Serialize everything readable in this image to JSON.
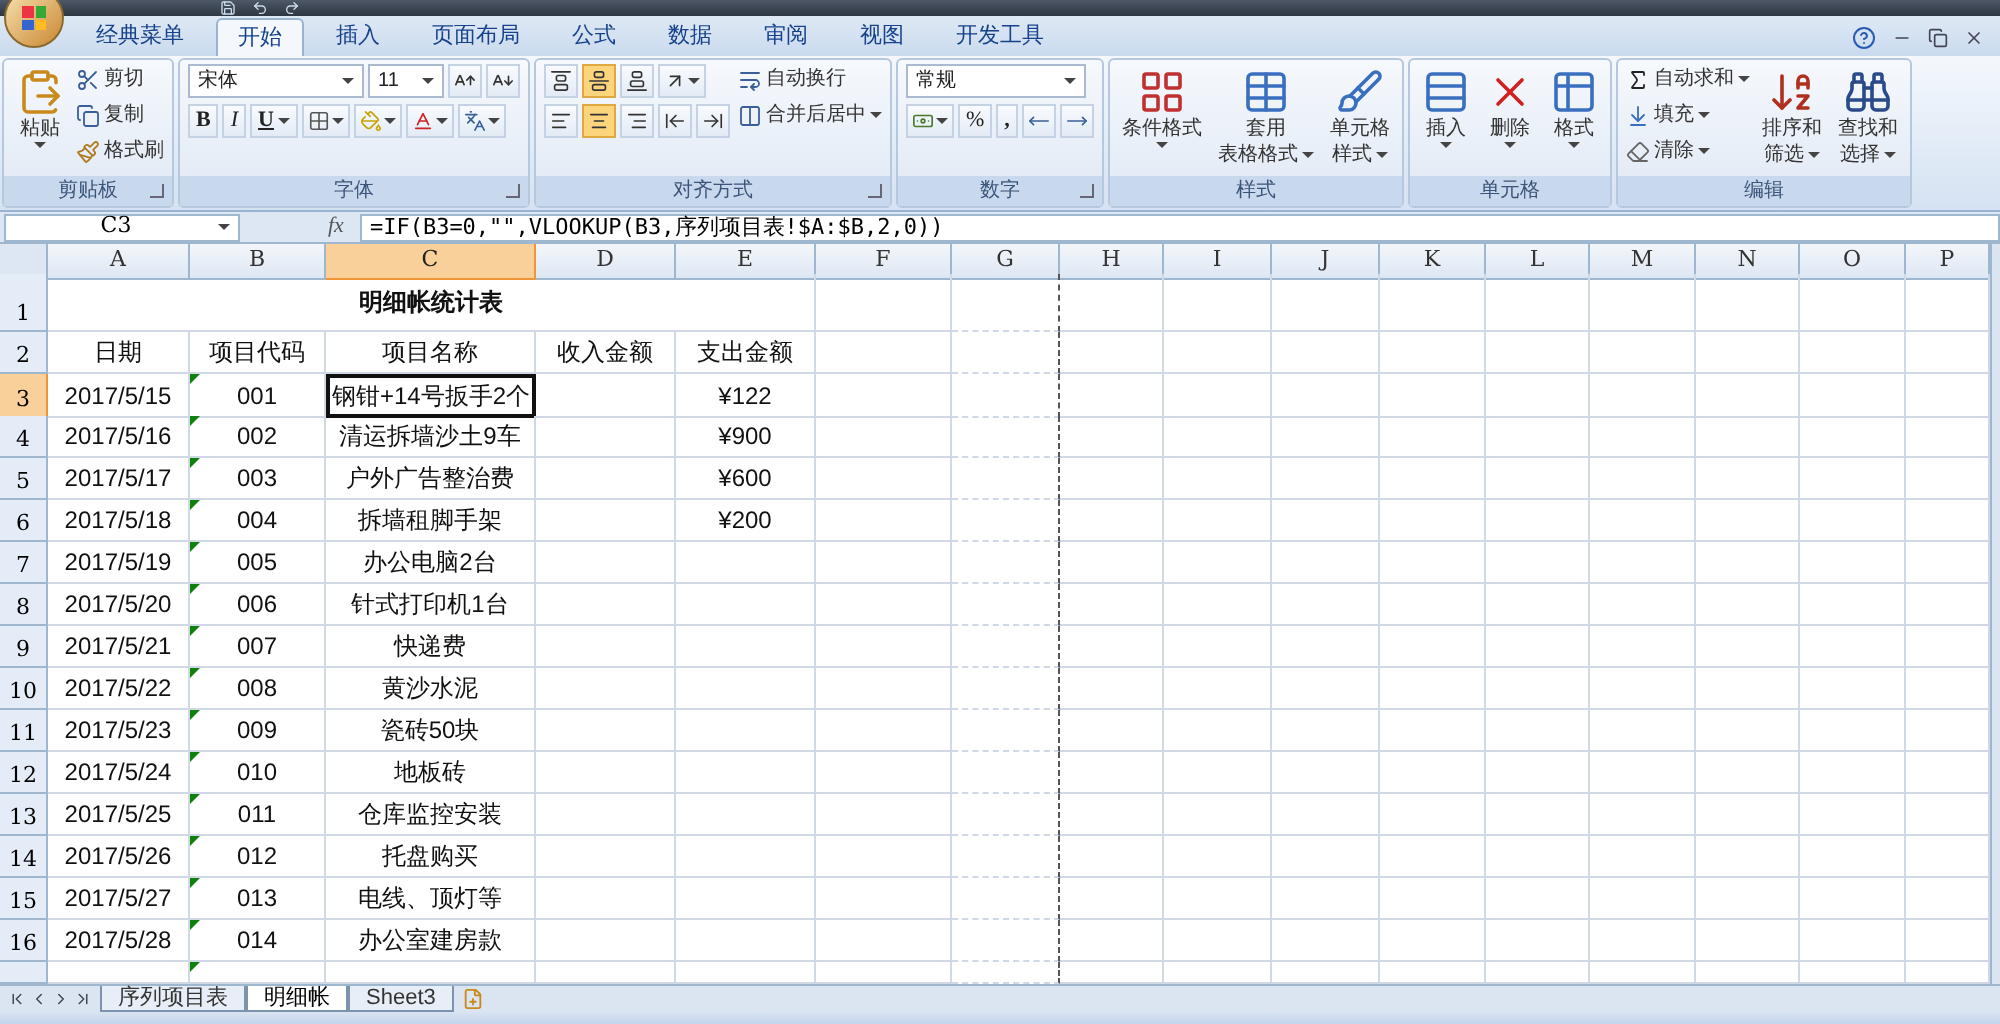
{
  "ribbon_tabs": [
    {
      "label": "经典菜单",
      "selected": false
    },
    {
      "label": "开始",
      "selected": true
    },
    {
      "label": "插入",
      "selected": false
    },
    {
      "label": "页面布局",
      "selected": false
    },
    {
      "label": "公式",
      "selected": false
    },
    {
      "label": "数据",
      "selected": false
    },
    {
      "label": "审阅",
      "selected": false
    },
    {
      "label": "视图",
      "selected": false
    },
    {
      "label": "开发工具",
      "selected": false
    }
  ],
  "ribbon_groups": [
    {
      "label": "剪贴板",
      "launcher": true,
      "columns": [
        [
          {
            "kind": "large",
            "lines": [
              "粘贴"
            ],
            "dropdown": true
          }
        ],
        [
          {
            "kind": "small",
            "label": "剪切",
            "dropdown": false
          },
          {
            "kind": "small",
            "label": "复制",
            "dropdown": false
          },
          {
            "kind": "small",
            "label": "格式刷",
            "dropdown": false
          }
        ]
      ]
    },
    {
      "label": "字体",
      "launcher": true,
      "columns": [
        [
          {
            "kind": "row",
            "items": [
              {
                "kind": "combo",
                "value": "宋体"
              },
              {
                "kind": "combo",
                "value": "11"
              },
              {
                "kind": "icon",
                "dropdown": false
              },
              {
                "kind": "icon",
                "dropdown": false
              }
            ]
          },
          {
            "kind": "row",
            "items": [
              {
                "kind": "text",
                "label": "B",
                "dropdown": false
              },
              {
                "kind": "text",
                "label": "I",
                "dropdown": false
              },
              {
                "kind": "text",
                "label": "U",
                "dropdown": true
              },
              {
                "kind": "icon",
                "dropdown": true
              },
              {
                "kind": "icon",
                "dropdown": true
              },
              {
                "kind": "icon",
                "dropdown": true
              },
              {
                "kind": "icon",
                "dropdown": true
              }
            ]
          }
        ]
      ]
    },
    {
      "label": "对齐方式",
      "launcher": true,
      "columns": [
        [
          {
            "kind": "row",
            "items": [
              {
                "kind": "icon",
                "selected": false,
                "dropdown": false
              },
              {
                "kind": "icon",
                "selected": true,
                "dropdown": false
              },
              {
                "kind": "icon",
                "selected": false,
                "dropdown": false
              },
              {
                "kind": "icon",
                "dropdown": true
              }
            ]
          },
          {
            "kind": "row",
            "items": [
              {
                "kind": "icon",
                "selected": false,
                "dropdown": false
              },
              {
                "kind": "icon",
                "selected": true,
                "dropdown": false
              },
              {
                "kind": "icon",
                "selected": false,
                "dropdown": false
              },
              {
                "kind": "icon",
                "dropdown": false
              },
              {
                "kind": "icon",
                "dropdown": false
              }
            ]
          }
        ],
        [
          {
            "kind": "small",
            "label": "自动换行",
            "dropdown": false
          },
          {
            "kind": "small",
            "label": "合并后居中",
            "dropdown": true
          }
        ]
      ]
    },
    {
      "label": "数字",
      "launcher": true,
      "columns": [
        [
          {
            "kind": "row",
            "items": [
              {
                "kind": "combo",
                "value": "常规"
              }
            ]
          },
          {
            "kind": "row",
            "items": [
              {
                "kind": "icon",
                "dropdown": true
              },
              {
                "kind": "text",
                "label": "%",
                "dropdown": false
              },
              {
                "kind": "text",
                "label": ",",
                "dropdown": false
              },
              {
                "kind": "icon",
                "dropdown": false
              },
              {
                "kind": "icon",
                "dropdown": false
              }
            ]
          }
        ]
      ]
    },
    {
      "label": "样式",
      "launcher": false,
      "columns": [
        [
          {
            "kind": "large",
            "lines": [
              "条件格式"
            ],
            "dropdown": true
          }
        ],
        [
          {
            "kind": "large",
            "lines": [
              "套用",
              "表格格式"
            ],
            "dropdown": true
          }
        ],
        [
          {
            "kind": "large",
            "lines": [
              "单元格",
              "样式"
            ],
            "dropdown": true
          }
        ]
      ]
    },
    {
      "label": "单元格",
      "launcher": false,
      "columns": [
        [
          {
            "kind": "large",
            "lines": [
              "插入"
            ],
            "dropdown": true
          }
        ],
        [
          {
            "kind": "large",
            "lines": [
              "删除"
            ],
            "dropdown": true
          }
        ],
        [
          {
            "kind": "large",
            "lines": [
              "格式"
            ],
            "dropdown": true
          }
        ]
      ]
    },
    {
      "label": "编辑",
      "launcher": false,
      "columns": [
        [
          {
            "kind": "small",
            "label": "自动求和",
            "dropdown": true
          },
          {
            "kind": "small",
            "label": "填充",
            "dropdown": true
          },
          {
            "kind": "small",
            "label": "清除",
            "dropdown": true
          }
        ],
        [
          {
            "kind": "large",
            "lines": [
              "排序和",
              "筛选"
            ],
            "dropdown": true
          }
        ],
        [
          {
            "kind": "large",
            "lines": [
              "查找和",
              "选择"
            ],
            "dropdown": true
          }
        ]
      ]
    }
  ],
  "formula_bar": {
    "name_box": "C3",
    "function_button": "fx",
    "formula": "=IF(B3=0,\"\",VLOOKUP(B3,序列项目表!$A:$B,2,0))"
  },
  "columns": [
    {
      "label": "A",
      "selected": false
    },
    {
      "label": "B",
      "selected": false
    },
    {
      "label": "C",
      "selected": true
    },
    {
      "label": "D",
      "selected": false
    },
    {
      "label": "E",
      "selected": false
    },
    {
      "label": "F",
      "selected": false
    },
    {
      "label": "G",
      "selected": false
    },
    {
      "label": "H",
      "selected": false
    },
    {
      "label": "I",
      "selected": false
    },
    {
      "label": "J",
      "selected": false
    },
    {
      "label": "K",
      "selected": false
    },
    {
      "label": "L",
      "selected": false
    },
    {
      "label": "M",
      "selected": false
    },
    {
      "label": "N",
      "selected": false
    },
    {
      "label": "O",
      "selected": false
    },
    {
      "label": "P",
      "selected": false
    }
  ],
  "rows": [
    {
      "number": "1",
      "kind": "title",
      "selected": false,
      "title": "明细帐统计表"
    },
    {
      "number": "2",
      "kind": "data",
      "selected": false,
      "cells": [
        {
          "text": "日期",
          "selected": false
        },
        {
          "text": "项目代码",
          "selected": false,
          "flag": false
        },
        {
          "text": "项目名称",
          "selected": false
        },
        {
          "text": "收入金额",
          "selected": false
        },
        {
          "text": "支出金额",
          "selected": false
        }
      ]
    },
    {
      "number": "3",
      "kind": "data",
      "selected": true,
      "cells": [
        {
          "text": "2017/5/15",
          "selected": false
        },
        {
          "text": "001",
          "selected": false,
          "flag": true
        },
        {
          "text": "钢钳+14号扳手2个",
          "selected": true
        },
        {
          "selected": false
        },
        {
          "text": "¥122",
          "selected": false
        }
      ]
    },
    {
      "number": "4",
      "kind": "data",
      "selected": false,
      "cells": [
        {
          "text": "2017/5/16",
          "selected": false
        },
        {
          "text": "002",
          "selected": false,
          "flag": true
        },
        {
          "text": "清运拆墙沙土9车",
          "selected": false
        },
        {
          "selected": false
        },
        {
          "text": "¥900",
          "selected": false
        }
      ]
    },
    {
      "number": "5",
      "kind": "data",
      "selected": false,
      "cells": [
        {
          "text": "2017/5/17",
          "selected": false
        },
        {
          "text": "003",
          "selected": false,
          "flag": true
        },
        {
          "text": "户外广告整治费",
          "selected": false
        },
        {
          "selected": false
        },
        {
          "text": "¥600",
          "selected": false
        }
      ]
    },
    {
      "number": "6",
      "kind": "data",
      "selected": false,
      "cells": [
        {
          "text": "2017/5/18",
          "selected": false
        },
        {
          "text": "004",
          "selected": false,
          "flag": true
        },
        {
          "text": "拆墙租脚手架",
          "selected": false
        },
        {
          "selected": false
        },
        {
          "text": "¥200",
          "selected": false
        }
      ]
    },
    {
      "number": "7",
      "kind": "data",
      "selected": false,
      "cells": [
        {
          "text": "2017/5/19",
          "selected": false
        },
        {
          "text": "005",
          "selected": false,
          "flag": true
        },
        {
          "text": "办公电脑2台",
          "selected": false
        },
        {
          "selected": false
        },
        {
          "selected": false
        }
      ]
    },
    {
      "number": "8",
      "kind": "data",
      "selected": false,
      "cells": [
        {
          "text": "2017/5/20",
          "selected": false
        },
        {
          "text": "006",
          "selected": false,
          "flag": true
        },
        {
          "text": "针式打印机1台",
          "selected": false
        },
        {
          "selected": false
        },
        {
          "selected": false
        }
      ]
    },
    {
      "number": "9",
      "kind": "data",
      "selected": false,
      "cells": [
        {
          "text": "2017/5/21",
          "selected": false
        },
        {
          "text": "007",
          "selected": false,
          "flag": true
        },
        {
          "text": "快递费",
          "selected": false
        },
        {
          "selected": false
        },
        {
          "selected": false
        }
      ]
    },
    {
      "number": "10",
      "kind": "data",
      "selected": false,
      "cells": [
        {
          "text": "2017/5/22",
          "selected": false
        },
        {
          "text": "008",
          "selected": false,
          "flag": true
        },
        {
          "text": "黄沙水泥",
          "selected": false
        },
        {
          "selected": false
        },
        {
          "selected": false
        }
      ]
    },
    {
      "number": "11",
      "kind": "data",
      "selected": false,
      "cells": [
        {
          "text": "2017/5/23",
          "selected": false
        },
        {
          "text": "009",
          "selected": false,
          "flag": true
        },
        {
          "text": "瓷砖50块",
          "selected": false
        },
        {
          "selected": false
        },
        {
          "selected": false
        }
      ]
    },
    {
      "number": "12",
      "kind": "data",
      "selected": false,
      "cells": [
        {
          "text": "2017/5/24",
          "selected": false
        },
        {
          "text": "010",
          "selected": false,
          "flag": true
        },
        {
          "text": "地板砖",
          "selected": false
        },
        {
          "selected": false
        },
        {
          "selected": false
        }
      ]
    },
    {
      "number": "13",
      "kind": "data",
      "selected": false,
      "cells": [
        {
          "text": "2017/5/25",
          "selected": false
        },
        {
          "text": "011",
          "selected": false,
          "flag": true
        },
        {
          "text": "仓库监控安装",
          "selected": false
        },
        {
          "selected": false
        },
        {
          "selected": false
        }
      ]
    },
    {
      "number": "14",
      "kind": "data",
      "selected": false,
      "cells": [
        {
          "text": "2017/5/26",
          "selected": false
        },
        {
          "text": "012",
          "selected": false,
          "flag": true
        },
        {
          "text": "托盘购买",
          "selected": false
        },
        {
          "selected": false
        },
        {
          "selected": false
        }
      ]
    },
    {
      "number": "15",
      "kind": "data",
      "selected": false,
      "cells": [
        {
          "text": "2017/5/27",
          "selected": false
        },
        {
          "text": "013",
          "selected": false,
          "flag": true
        },
        {
          "text": "电线、顶灯等",
          "selected": false
        },
        {
          "selected": false
        },
        {
          "selected": false
        }
      ]
    },
    {
      "number": "16",
      "kind": "data",
      "selected": false,
      "cells": [
        {
          "text": "2017/5/28",
          "selected": false
        },
        {
          "text": "014",
          "selected": false,
          "flag": true
        },
        {
          "text": "办公室建房款",
          "selected": false
        },
        {
          "selected": false
        },
        {
          "selected": false
        }
      ]
    },
    {
      "number": "",
      "kind": "partial",
      "selected": false,
      "cells": [
        {
          "selected": false
        },
        {
          "selected": false,
          "flag": true
        },
        {
          "selected": false
        },
        {
          "selected": false
        },
        {
          "selected": false
        }
      ]
    }
  ],
  "sheet_tabs": [
    {
      "label": "序列项目表",
      "selected": false
    },
    {
      "label": "明细帐",
      "selected": true
    },
    {
      "label": "Sheet3",
      "selected": false
    }
  ]
}
